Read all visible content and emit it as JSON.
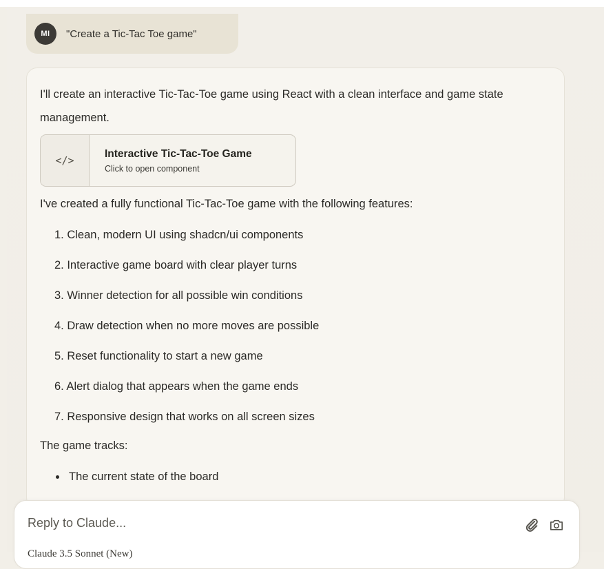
{
  "user_message": {
    "avatar_initials": "MI",
    "text": "\"Create a Tic-Tac Toe game\""
  },
  "assistant": {
    "intro": "I'll create an interactive Tic-Tac-Toe game using React with a clean interface and game state management.",
    "artifact": {
      "icon": "code-icon",
      "icon_glyph": "</>",
      "title": "Interactive Tic-Tac-Toe Game",
      "subtitle": "Click to open component"
    },
    "features_intro": "I've created a fully functional Tic-Tac-Toe game with the following features:",
    "features": [
      "1. Clean, modern UI using shadcn/ui components",
      "2. Interactive game board with clear player turns",
      "3. Winner detection for all possible win conditions",
      "4. Draw detection when no more moves are possible",
      "5. Reset functionality to start a new game",
      "6. Alert dialog that appears when the game ends",
      "7. Responsive design that works on all screen sizes"
    ],
    "tracks_label": "The game tracks:",
    "tracks": [
      "The current state of the board"
    ]
  },
  "reply": {
    "placeholder": "Reply to Claude...",
    "model": "Claude 3.5 Sonnet (New)",
    "attach_icon": "paperclip-icon",
    "camera_icon": "camera-icon"
  },
  "colors": {
    "background": "#f2efe8",
    "user_bubble": "#e8e3d5",
    "avatar": "#3c3a36",
    "card": "#f8f6f1"
  }
}
